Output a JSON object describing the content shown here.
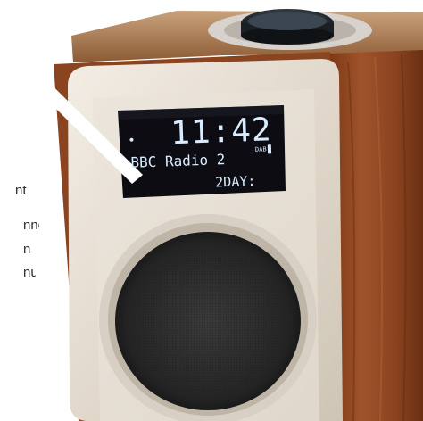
{
  "display": {
    "time": "11:42",
    "station": "BBC Radio 2",
    "scroll_text": "2DAY:",
    "band": "DAB"
  },
  "caption_fragments": [
    "nt",
    "nnol",
    "n",
    "nu."
  ],
  "colors": {
    "wood": "#9a4a1a",
    "panel": "#e7dfd3",
    "lcd": "#0c0c12",
    "lcd_text": "#d9ecff",
    "speaker_grille": "#2b2b2b"
  }
}
